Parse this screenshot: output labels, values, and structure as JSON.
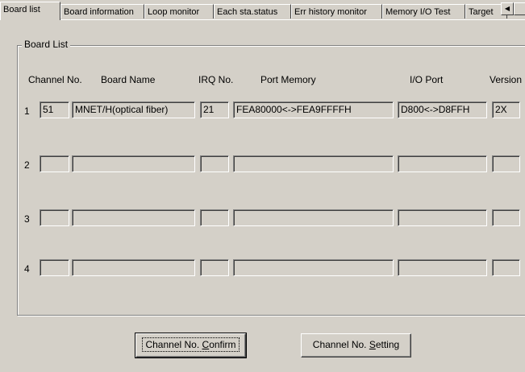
{
  "tabs": [
    {
      "label": "Board list",
      "active": true
    },
    {
      "label": "Board information"
    },
    {
      "label": "Loop monitor"
    },
    {
      "label": "Each sta.status"
    },
    {
      "label": "Err history monitor"
    },
    {
      "label": "Memory I/O Test"
    },
    {
      "label": "Target"
    }
  ],
  "tab_scroll_left": "◀",
  "group_title": "Board List",
  "columns": {
    "channel": "Channel No.",
    "board": "Board Name",
    "irq": "IRQ No.",
    "port_memory": "Port Memory",
    "io_port": "I/O Port",
    "version": "Version"
  },
  "rows": [
    {
      "num": "1",
      "channel": "51",
      "board": "MNET/H(optical fiber)",
      "irq": "21",
      "port_memory": "FEA80000<->FEA9FFFFH",
      "io_port": "D800<->D8FFH",
      "version": "2X"
    },
    {
      "num": "2",
      "channel": "",
      "board": "",
      "irq": "",
      "port_memory": "",
      "io_port": "",
      "version": ""
    },
    {
      "num": "3",
      "channel": "",
      "board": "",
      "irq": "",
      "port_memory": "",
      "io_port": "",
      "version": ""
    },
    {
      "num": "4",
      "channel": "",
      "board": "",
      "irq": "",
      "port_memory": "",
      "io_port": "",
      "version": ""
    }
  ],
  "buttons": {
    "confirm_prefix": "Channel No. ",
    "confirm_hotkey": "C",
    "confirm_suffix": "onfirm",
    "setting_prefix": "Channel No. ",
    "setting_hotkey": "S",
    "setting_suffix": "etting"
  }
}
